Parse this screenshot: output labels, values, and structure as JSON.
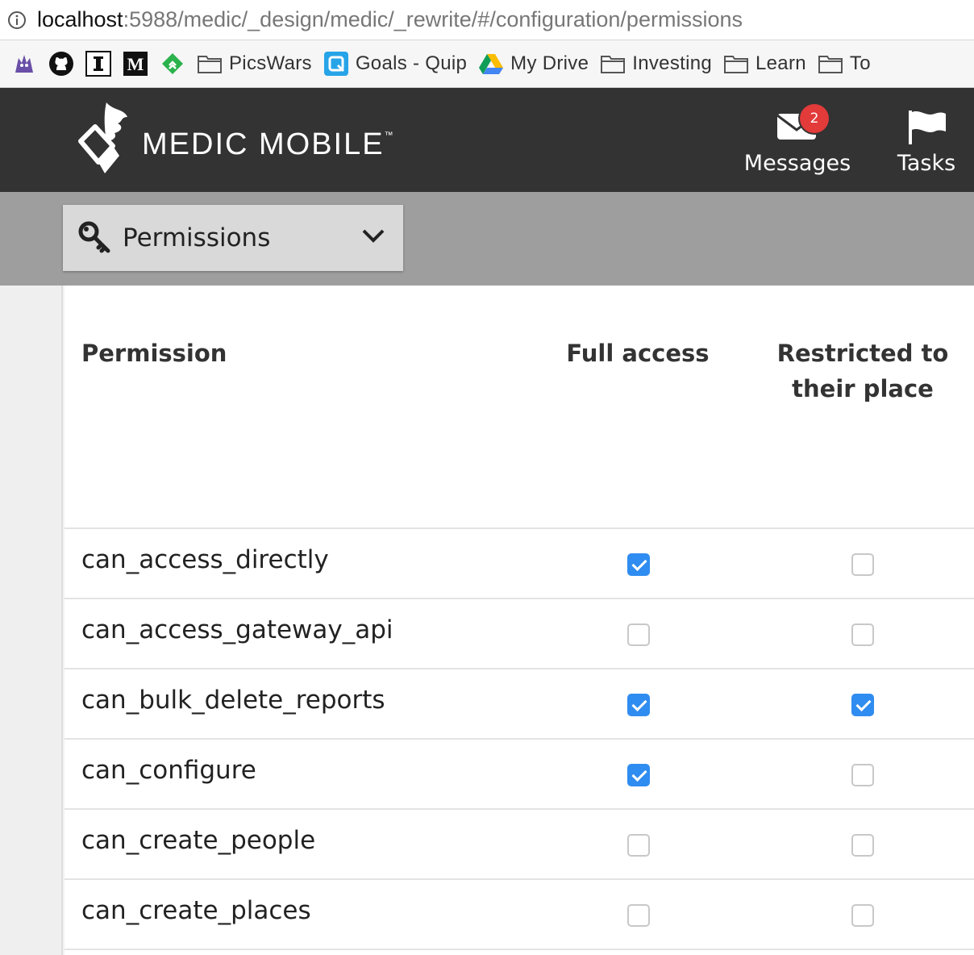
{
  "browser": {
    "url_host": "localhost",
    "url_path": ":5988/medic/_design/medic/_rewrite/#/configuration/permissions",
    "bookmarks": [
      {
        "label": "",
        "icon": "gargoyle-icon"
      },
      {
        "label": "",
        "icon": "github-icon"
      },
      {
        "label": "",
        "icon": "instapaper-icon"
      },
      {
        "label": "",
        "icon": "medium-icon"
      },
      {
        "label": "",
        "icon": "feedly-icon"
      },
      {
        "label": "PicsWars",
        "icon": "folder-icon"
      },
      {
        "label": "Goals - Quip",
        "icon": "quip-icon"
      },
      {
        "label": "My Drive",
        "icon": "google-drive-icon"
      },
      {
        "label": "Investing",
        "icon": "folder-icon"
      },
      {
        "label": "Learn",
        "icon": "folder-icon"
      },
      {
        "label": "To",
        "icon": "folder-icon"
      }
    ]
  },
  "header": {
    "logo_text": "MEDIC MOBILE",
    "logo_tm": "™",
    "messages_label": "Messages",
    "messages_badge": "2",
    "tasks_label": "Tasks"
  },
  "filter": {
    "dropdown_label": "Permissions",
    "icon": "key-icon"
  },
  "table": {
    "columns": {
      "permission": "Permission",
      "full_access": "Full access",
      "restricted_line1": "Restricted to",
      "restricted_line2": "their place"
    },
    "rows": [
      {
        "name": "can_access_directly",
        "full": true,
        "restricted": false
      },
      {
        "name": "can_access_gateway_api",
        "full": false,
        "restricted": false
      },
      {
        "name": "can_bulk_delete_reports",
        "full": true,
        "restricted": true
      },
      {
        "name": "can_configure",
        "full": true,
        "restricted": false
      },
      {
        "name": "can_create_people",
        "full": false,
        "restricted": false
      },
      {
        "name": "can_create_places",
        "full": false,
        "restricted": false
      }
    ]
  },
  "colors": {
    "header_bg": "#333333",
    "strip_bg": "#9e9e9e",
    "checkbox_checked": "#2f8cf0",
    "badge": "#e33a3a"
  }
}
